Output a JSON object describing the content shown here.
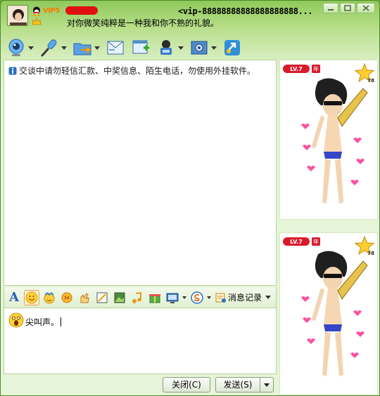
{
  "title_bar": {
    "vip_label": "VIP5",
    "contact_id": "<vip-88888888888888888888...",
    "signature": "对你微笑纯粹是一种我和你不熟的礼貌。"
  },
  "toolbar": {
    "items": [
      "video-call",
      "voice-call",
      "send-file",
      "send-mail",
      "add-app",
      "remote-assist",
      "settings",
      "transfer"
    ]
  },
  "chat": {
    "notice": "交谈中请勿轻信汇款、中奖信息、陌生电话，勿使用外挂软件。"
  },
  "input_toolbar": {
    "msg_record_label": "消息记录"
  },
  "input": {
    "text": "尖叫声。"
  },
  "buttons": {
    "close_label": "关闭(C)",
    "send_label": "发送(S)"
  },
  "show_panels": [
    {
      "level": "LV.7",
      "year_badge": "年",
      "star_value": "78"
    },
    {
      "level": "LV.7",
      "year_badge": "年",
      "star_value": "78"
    }
  ],
  "colors": {
    "frame_green": "#8fc95a",
    "vip_orange": "#ff7a00",
    "badge_red": "#d81b2c",
    "redaction_red": "#e01010"
  }
}
